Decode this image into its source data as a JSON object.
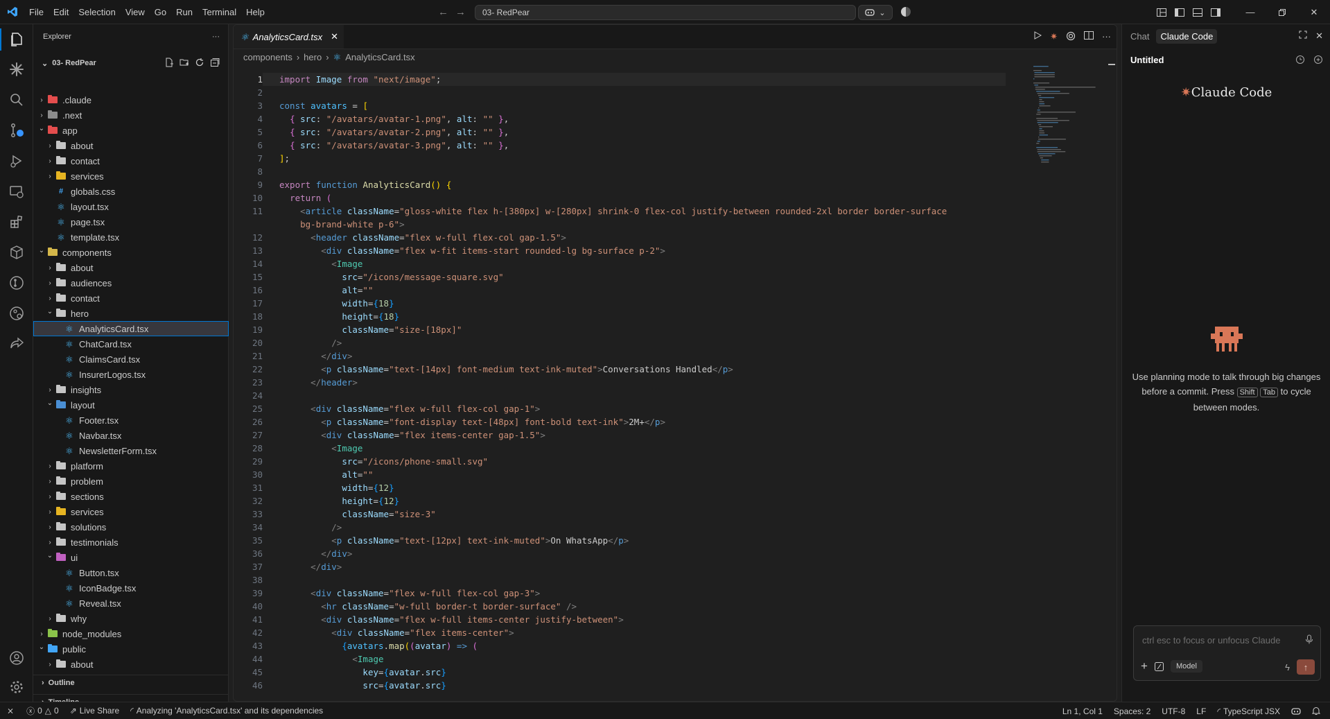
{
  "menu": [
    "File",
    "Edit",
    "Selection",
    "View",
    "Go",
    "Run",
    "Terminal",
    "Help"
  ],
  "search": {
    "text": "03- RedPear"
  },
  "explorer": {
    "title": "Explorer",
    "root": "03- RedPear",
    "tree": [
      {
        "label": ".claude",
        "depth": 1,
        "kind": "folder",
        "open": false,
        "color": "#e44d4d"
      },
      {
        "label": ".next",
        "depth": 1,
        "kind": "folder",
        "open": false,
        "color": "#8c8c8c"
      },
      {
        "label": "app",
        "depth": 1,
        "kind": "folder",
        "open": true,
        "color": "#e44d4d"
      },
      {
        "label": "about",
        "depth": 2,
        "kind": "folder",
        "open": false,
        "color": "#c5c5c5"
      },
      {
        "label": "contact",
        "depth": 2,
        "kind": "folder",
        "open": false,
        "color": "#c5c5c5"
      },
      {
        "label": "services",
        "depth": 2,
        "kind": "folder",
        "open": false,
        "color": "#e6b422"
      },
      {
        "label": "globals.css",
        "depth": 2,
        "kind": "css"
      },
      {
        "label": "layout.tsx",
        "depth": 2,
        "kind": "react"
      },
      {
        "label": "page.tsx",
        "depth": 2,
        "kind": "react"
      },
      {
        "label": "template.tsx",
        "depth": 2,
        "kind": "react"
      },
      {
        "label": "components",
        "depth": 1,
        "kind": "folder",
        "open": true,
        "color": "#d4b74a"
      },
      {
        "label": "about",
        "depth": 2,
        "kind": "folder",
        "open": false,
        "color": "#c5c5c5"
      },
      {
        "label": "audiences",
        "depth": 2,
        "kind": "folder",
        "open": false,
        "color": "#c5c5c5"
      },
      {
        "label": "contact",
        "depth": 2,
        "kind": "folder",
        "open": false,
        "color": "#c5c5c5"
      },
      {
        "label": "hero",
        "depth": 2,
        "kind": "folder",
        "open": true,
        "color": "#c5c5c5"
      },
      {
        "label": "AnalyticsCard.tsx",
        "depth": 3,
        "kind": "react",
        "selected": true
      },
      {
        "label": "ChatCard.tsx",
        "depth": 3,
        "kind": "react"
      },
      {
        "label": "ClaimsCard.tsx",
        "depth": 3,
        "kind": "react"
      },
      {
        "label": "InsurerLogos.tsx",
        "depth": 3,
        "kind": "react"
      },
      {
        "label": "insights",
        "depth": 2,
        "kind": "folder",
        "open": false,
        "color": "#c5c5c5"
      },
      {
        "label": "layout",
        "depth": 2,
        "kind": "folder",
        "open": true,
        "color": "#4a8fd4"
      },
      {
        "label": "Footer.tsx",
        "depth": 3,
        "kind": "react"
      },
      {
        "label": "Navbar.tsx",
        "depth": 3,
        "kind": "react"
      },
      {
        "label": "NewsletterForm.tsx",
        "depth": 3,
        "kind": "react"
      },
      {
        "label": "platform",
        "depth": 2,
        "kind": "folder",
        "open": false,
        "color": "#c5c5c5"
      },
      {
        "label": "problem",
        "depth": 2,
        "kind": "folder",
        "open": false,
        "color": "#c5c5c5"
      },
      {
        "label": "sections",
        "depth": 2,
        "kind": "folder",
        "open": false,
        "color": "#c5c5c5"
      },
      {
        "label": "services",
        "depth": 2,
        "kind": "folder",
        "open": false,
        "color": "#e6b422"
      },
      {
        "label": "solutions",
        "depth": 2,
        "kind": "folder",
        "open": false,
        "color": "#c5c5c5"
      },
      {
        "label": "testimonials",
        "depth": 2,
        "kind": "folder",
        "open": false,
        "color": "#c5c5c5"
      },
      {
        "label": "ui",
        "depth": 2,
        "kind": "folder",
        "open": true,
        "color": "#c060c0"
      },
      {
        "label": "Button.tsx",
        "depth": 3,
        "kind": "react"
      },
      {
        "label": "IconBadge.tsx",
        "depth": 3,
        "kind": "react"
      },
      {
        "label": "Reveal.tsx",
        "depth": 3,
        "kind": "react"
      },
      {
        "label": "why",
        "depth": 2,
        "kind": "folder",
        "open": false,
        "color": "#c5c5c5"
      },
      {
        "label": "node_modules",
        "depth": 1,
        "kind": "folder",
        "open": false,
        "color": "#8bc34a"
      },
      {
        "label": "public",
        "depth": 1,
        "kind": "folder",
        "open": true,
        "color": "#42a5f5"
      },
      {
        "label": "about",
        "depth": 2,
        "kind": "folder",
        "open": false,
        "color": "#c5c5c5"
      }
    ],
    "outline": "Outline",
    "timeline": "Timeline"
  },
  "editor": {
    "tab": "AnalyticsCard.tsx",
    "breadcrumb": [
      "components",
      "hero",
      "AnalyticsCard.tsx"
    ],
    "lines": [
      {
        "n": "1",
        "html": "<span class='k'>import</span> <span class='v'>Image</span> <span class='k'>from</span> <span class='s'>\"next/image\"</span>;"
      },
      {
        "n": "2",
        "html": ""
      },
      {
        "n": "3",
        "html": "<span class='kb'>const</span> <span class='c'>avatars</span> = <span class='br'>[</span>"
      },
      {
        "n": "4",
        "html": "  <span class='br2'>{</span> <span class='a'>src</span>: <span class='s'>\"/avatars/avatar-1.png\"</span>, <span class='a'>alt</span>: <span class='s'>\"\"</span> <span class='br2'>}</span>,"
      },
      {
        "n": "5",
        "html": "  <span class='br2'>{</span> <span class='a'>src</span>: <span class='s'>\"/avatars/avatar-2.png\"</span>, <span class='a'>alt</span>: <span class='s'>\"\"</span> <span class='br2'>}</span>,"
      },
      {
        "n": "6",
        "html": "  <span class='br2'>{</span> <span class='a'>src</span>: <span class='s'>\"/avatars/avatar-3.png\"</span>, <span class='a'>alt</span>: <span class='s'>\"\"</span> <span class='br2'>}</span>,"
      },
      {
        "n": "7",
        "html": "<span class='br'>]</span>;"
      },
      {
        "n": "8",
        "html": ""
      },
      {
        "n": "9",
        "html": "<span class='k'>export</span> <span class='kb'>function</span> <span class='f'>AnalyticsCard</span><span class='br'>()</span> <span class='br'>{</span>"
      },
      {
        "n": "10",
        "html": "  <span class='k'>return</span> <span class='br2'>(</span>"
      },
      {
        "n": "11",
        "html": "    <span class='p'>&lt;</span><span class='t'>article</span> <span class='a'>className</span>=<span class='s'>\"gloss-white flex h-[380px] w-[280px] shrink-0 flex-col justify-between rounded-2xl border border-surface</span>"
      },
      {
        "n": "",
        "html": "    <span class='s'>bg-brand-white p-6\"</span><span class='p'>&gt;</span>"
      },
      {
        "n": "12",
        "html": "      <span class='p'>&lt;</span><span class='t'>header</span> <span class='a'>className</span>=<span class='s'>\"flex w-full flex-col gap-1.5\"</span><span class='p'>&gt;</span>"
      },
      {
        "n": "13",
        "html": "        <span class='p'>&lt;</span><span class='t'>div</span> <span class='a'>className</span>=<span class='s'>\"flex w-fit items-start rounded-lg bg-surface p-2\"</span><span class='p'>&gt;</span>"
      },
      {
        "n": "14",
        "html": "          <span class='p'>&lt;</span><span class='tag'>Image</span>"
      },
      {
        "n": "15",
        "html": "            <span class='a'>src</span>=<span class='s'>\"/icons/message-square.svg\"</span>"
      },
      {
        "n": "16",
        "html": "            <span class='a'>alt</span>=<span class='s'>\"\"</span>"
      },
      {
        "n": "17",
        "html": "            <span class='a'>width</span>=<span class='br3'>{</span><span class='n'>18</span><span class='br3'>}</span>"
      },
      {
        "n": "18",
        "html": "            <span class='a'>height</span>=<span class='br3'>{</span><span class='n'>18</span><span class='br3'>}</span>"
      },
      {
        "n": "19",
        "html": "            <span class='a'>className</span>=<span class='s'>\"size-[18px]\"</span>"
      },
      {
        "n": "20",
        "html": "          <span class='p'>/&gt;</span>"
      },
      {
        "n": "21",
        "html": "        <span class='p'>&lt;/</span><span class='t'>div</span><span class='p'>&gt;</span>"
      },
      {
        "n": "22",
        "html": "        <span class='p'>&lt;</span><span class='t'>p</span> <span class='a'>className</span>=<span class='s'>\"text-[14px] font-medium text-ink-muted\"</span><span class='p'>&gt;</span>Conversations Handled<span class='p'>&lt;/</span><span class='t'>p</span><span class='p'>&gt;</span>"
      },
      {
        "n": "23",
        "html": "      <span class='p'>&lt;/</span><span class='t'>header</span><span class='p'>&gt;</span>"
      },
      {
        "n": "24",
        "html": ""
      },
      {
        "n": "25",
        "html": "      <span class='p'>&lt;</span><span class='t'>div</span> <span class='a'>className</span>=<span class='s'>\"flex w-full flex-col gap-1\"</span><span class='p'>&gt;</span>"
      },
      {
        "n": "26",
        "html": "        <span class='p'>&lt;</span><span class='t'>p</span> <span class='a'>className</span>=<span class='s'>\"font-display text-[48px] font-bold text-ink\"</span><span class='p'>&gt;</span>2M+<span class='p'>&lt;/</span><span class='t'>p</span><span class='p'>&gt;</span>"
      },
      {
        "n": "27",
        "html": "        <span class='p'>&lt;</span><span class='t'>div</span> <span class='a'>className</span>=<span class='s'>\"flex items-center gap-1.5\"</span><span class='p'>&gt;</span>"
      },
      {
        "n": "28",
        "html": "          <span class='p'>&lt;</span><span class='tag'>Image</span>"
      },
      {
        "n": "29",
        "html": "            <span class='a'>src</span>=<span class='s'>\"/icons/phone-small.svg\"</span>"
      },
      {
        "n": "30",
        "html": "            <span class='a'>alt</span>=<span class='s'>\"\"</span>"
      },
      {
        "n": "31",
        "html": "            <span class='a'>width</span>=<span class='br3'>{</span><span class='n'>12</span><span class='br3'>}</span>"
      },
      {
        "n": "32",
        "html": "            <span class='a'>height</span>=<span class='br3'>{</span><span class='n'>12</span><span class='br3'>}</span>"
      },
      {
        "n": "33",
        "html": "            <span class='a'>className</span>=<span class='s'>\"size-3\"</span>"
      },
      {
        "n": "34",
        "html": "          <span class='p'>/&gt;</span>"
      },
      {
        "n": "35",
        "html": "          <span class='p'>&lt;</span><span class='t'>p</span> <span class='a'>className</span>=<span class='s'>\"text-[12px] text-ink-muted\"</span><span class='p'>&gt;</span>On WhatsApp<span class='p'>&lt;/</span><span class='t'>p</span><span class='p'>&gt;</span>"
      },
      {
        "n": "36",
        "html": "        <span class='p'>&lt;/</span><span class='t'>div</span><span class='p'>&gt;</span>"
      },
      {
        "n": "37",
        "html": "      <span class='p'>&lt;/</span><span class='t'>div</span><span class='p'>&gt;</span>"
      },
      {
        "n": "38",
        "html": ""
      },
      {
        "n": "39",
        "html": "      <span class='p'>&lt;</span><span class='t'>div</span> <span class='a'>className</span>=<span class='s'>\"flex w-full flex-col gap-3\"</span><span class='p'>&gt;</span>"
      },
      {
        "n": "40",
        "html": "        <span class='p'>&lt;</span><span class='t'>hr</span> <span class='a'>className</span>=<span class='s'>\"w-full border-t border-surface\"</span> <span class='p'>/&gt;</span>"
      },
      {
        "n": "41",
        "html": "        <span class='p'>&lt;</span><span class='t'>div</span> <span class='a'>className</span>=<span class='s'>\"flex w-full items-center justify-between\"</span><span class='p'>&gt;</span>"
      },
      {
        "n": "42",
        "html": "          <span class='p'>&lt;</span><span class='t'>div</span> <span class='a'>className</span>=<span class='s'>\"flex items-center\"</span><span class='p'>&gt;</span>"
      },
      {
        "n": "43",
        "html": "            <span class='br3'>{</span><span class='c'>avatars</span>.<span class='f'>map</span><span class='br'>(</span><span class='br2'>(</span><span class='v'>avatar</span><span class='br2'>)</span> <span class='kb'>=&gt;</span> <span class='br2'>(</span>"
      },
      {
        "n": "44",
        "html": "              <span class='p'>&lt;</span><span class='tag'>Image</span>"
      },
      {
        "n": "45",
        "html": "                <span class='a'>key</span>=<span class='br3'>{</span><span class='v'>avatar</span>.<span class='v'>src</span><span class='br3'>}</span>"
      },
      {
        "n": "46",
        "html": "                <span class='a'>src</span>=<span class='br3'>{</span><span class='v'>avatar</span>.<span class='v'>src</span><span class='br3'>}</span>"
      }
    ]
  },
  "chat": {
    "tabs": [
      "Chat",
      "Claude Code"
    ],
    "active_tab": "Claude Code",
    "session_title": "Untitled",
    "brand": "Claude Code",
    "hint_pre": "Use planning mode to talk through big changes before a commit. Press",
    "key1": "Shift",
    "key2": "Tab",
    "hint_post": "to cycle between modes.",
    "placeholder": "ctrl esc to focus or unfocus Claude",
    "model_label": "Model"
  },
  "status": {
    "errors": "0",
    "warnings": "0",
    "live_share": "Live Share",
    "task": "Analyzing 'AnalyticsCard.tsx' and its dependencies",
    "cursor": "Ln 1, Col 1",
    "spaces": "Spaces: 2",
    "encoding": "UTF-8",
    "eol": "LF",
    "language": "TypeScript JSX"
  },
  "colors": {
    "accent": "#0078d4",
    "claude": "#d97757"
  }
}
